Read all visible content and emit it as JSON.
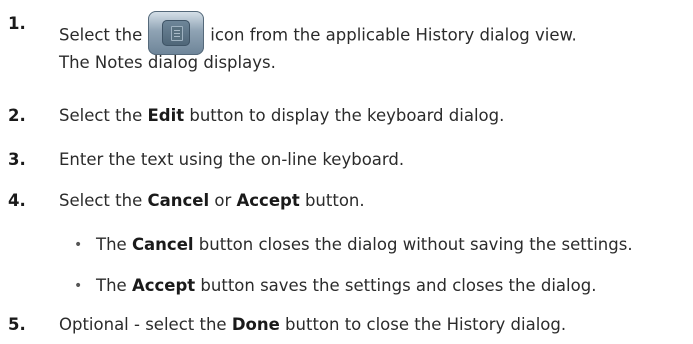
{
  "steps": [
    {
      "number": "1.",
      "before": "Select the",
      "after": "icon from the applicable History dialog view.",
      "result": "The Notes dialog displays."
    },
    {
      "number": "2.",
      "before": "Select the ",
      "bold": "Edit",
      "after": " button to display the keyboard dialog."
    },
    {
      "number": "3.",
      "text": "Enter the text using the on-line keyboard."
    },
    {
      "number": "4.",
      "before": "Select the ",
      "bold1": "Cancel",
      "middle": " or ",
      "bold2": "Accept",
      "after": " button."
    },
    {
      "number": "5.",
      "before": "Optional - select the ",
      "bold": "Done",
      "after": " button to close the History dialog."
    }
  ],
  "bullets": [
    {
      "symbol": "•",
      "before": "The ",
      "bold": "Cancel",
      "after": " button closes the dialog without saving the settings."
    },
    {
      "symbol": "•",
      "before": "The ",
      "bold": "Accept",
      "after": " button saves the settings and closes the dialog."
    }
  ],
  "icons": {
    "notes_button": "notes-icon"
  }
}
